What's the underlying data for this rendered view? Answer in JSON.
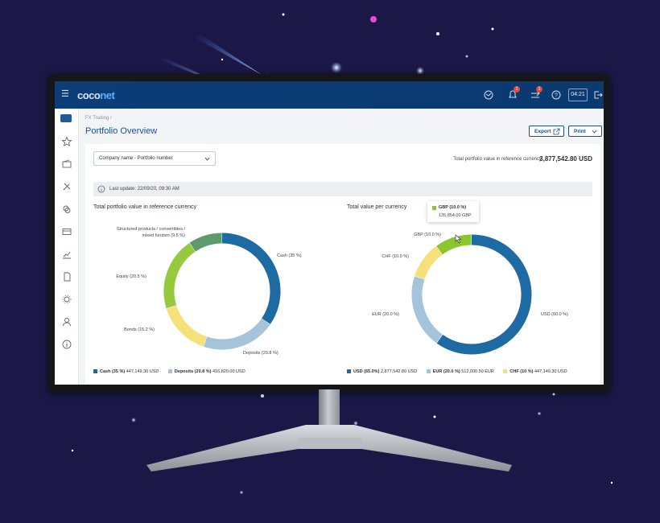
{
  "app": {
    "logo_left": "coco",
    "logo_right": "net",
    "clock": "04:21",
    "notification_counts": [
      "1",
      "1"
    ]
  },
  "breadcrumb": "FX Trading /",
  "page_title": "Portfolio Overview",
  "toolbar": {
    "export_label": "Export",
    "print_label": "Print"
  },
  "portfolio_select": {
    "value": "Company name - Portfolio number"
  },
  "total": {
    "label": "Total portfolio value in reference currency",
    "value": "3,877,542.80 USD"
  },
  "last_update": "Last update: 22/09/20, 09:30 AM",
  "colors": {
    "cash": "#1e6aa3",
    "deposits": "#a5c4dc",
    "bonds": "#f5e07a",
    "equity": "#96c93d",
    "structured": "#5f9a6d",
    "usd": "#1e6aa3",
    "eur": "#a5c4dc",
    "chf": "#f5e07a",
    "gbp": "#8bc530",
    "topbar": "#0c3d78",
    "accent": "#1d4f8f"
  },
  "chart_data": [
    {
      "type": "pie",
      "title": "Total portfolio value in reference currency",
      "slices": [
        {
          "label": "Cash (35 %)",
          "value": 35,
          "color": "#1e6aa3"
        },
        {
          "label": "Deposits (20.8 %)",
          "value": 20.8,
          "color": "#a5c4dc"
        },
        {
          "label": "Bonds (15.2 %)",
          "value": 15.2,
          "color": "#f5e07a"
        },
        {
          "label": "Equity (20.5 %)",
          "value": 20.5,
          "color": "#96c93d"
        },
        {
          "label": "Structured products / convertibles / mixed fundsm (9.5 %)",
          "value": 9.5,
          "color": "#5f9a6d"
        }
      ],
      "legend": [
        {
          "name": "Cash (35 %)",
          "amount": "447,149.30 USD",
          "color": "#1e6aa3"
        },
        {
          "name": "Deposits (20.8 %)",
          "amount": "416,820.00 USD",
          "color": "#a5c4dc"
        }
      ]
    },
    {
      "type": "pie",
      "title": "Total value per currency",
      "slices": [
        {
          "label": "USD (60.0 %)",
          "value": 60,
          "color": "#1e6aa3"
        },
        {
          "label": "EUR (20.0 %)",
          "value": 20,
          "color": "#a5c4dc"
        },
        {
          "label": "CHF (10.0 %)",
          "value": 10,
          "color": "#f5e07a"
        },
        {
          "label": "GBP (10.0 %)",
          "value": 10,
          "color": "#8bc530"
        }
      ],
      "legend": [
        {
          "name": "USD (65.0%)",
          "amount": "2,877,542.80 USD",
          "color": "#1e6aa3"
        },
        {
          "name": "EUR (20.0 %)",
          "amount": "512,000.50 EUR",
          "color": "#a5c4dc"
        },
        {
          "name": "CHF (10 %)",
          "amount": "447,149.30 USD",
          "color": "#f5e07a"
        }
      ],
      "tooltip": {
        "name": "GBP (10.0 %)",
        "amount": "135,854.00 GBP"
      }
    }
  ]
}
